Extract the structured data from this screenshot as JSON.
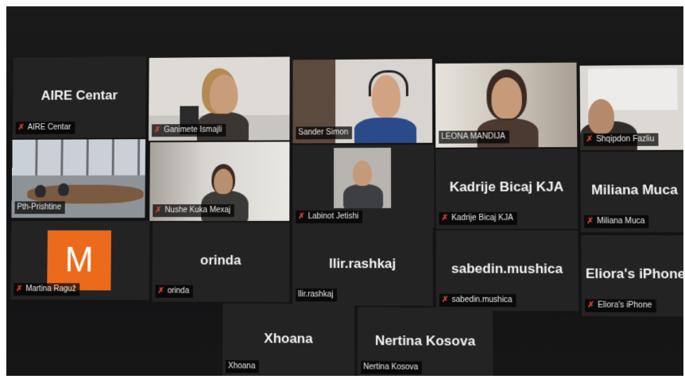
{
  "participants": [
    {
      "name": "AIRE Centar",
      "label": "AIRE Centar",
      "video": false
    },
    {
      "name": "Ganimete Ismajli",
      "label": "Ganimete Ismajli",
      "video": true
    },
    {
      "name": "Sander Simon",
      "label": "Sander Simon",
      "video": true
    },
    {
      "name": "LEONA MANDIJA",
      "label": "LEONA MANDIJA",
      "video": true,
      "active": true
    },
    {
      "name": "Shqipdon Fazliu",
      "label": "Shqipdon Fazliu",
      "video": true
    },
    {
      "name": "Pth-Prishtine",
      "label": "Pth-Prishtine",
      "video": true
    },
    {
      "name": "Nushe Kuka Mexaj",
      "label": "Nushe Kuka Mexaj",
      "video": true
    },
    {
      "name": "Labinot Jetishi",
      "label": "Labinot Jetishi",
      "video": true
    },
    {
      "name": "Kadrije Bicaj KJA",
      "label": "Kadrije Bicaj KJA",
      "video": false
    },
    {
      "name": "Miliana Muca",
      "label": "Miliana Muca",
      "video": false
    },
    {
      "name": "Martina Raguž",
      "label": "Martina Raguž",
      "video": false,
      "avatar_letter": "M"
    },
    {
      "name": "orinda",
      "label": "orinda",
      "video": false
    },
    {
      "name": "llir.rashkaj",
      "label": "llir.rashkaj",
      "video": false
    },
    {
      "name": "sabedin.mushica",
      "label": "sabedin.mushica",
      "video": false
    },
    {
      "name": "Eliora's iPhone",
      "label": "Eliora's iPhone",
      "video": false
    },
    {
      "name": "Xhoana",
      "label": "Xhoana",
      "video": false
    },
    {
      "name": "Nertina Kosova",
      "label": "Nertina Kosova",
      "video": false
    }
  ],
  "colors": {
    "active_speaker_border": "#c8e04a",
    "muted_icon": "#e0413a",
    "avatar_bg": "#ec6a1c",
    "tile_bg": "#232324"
  },
  "icons": {
    "muted": "mic-muted-icon"
  }
}
